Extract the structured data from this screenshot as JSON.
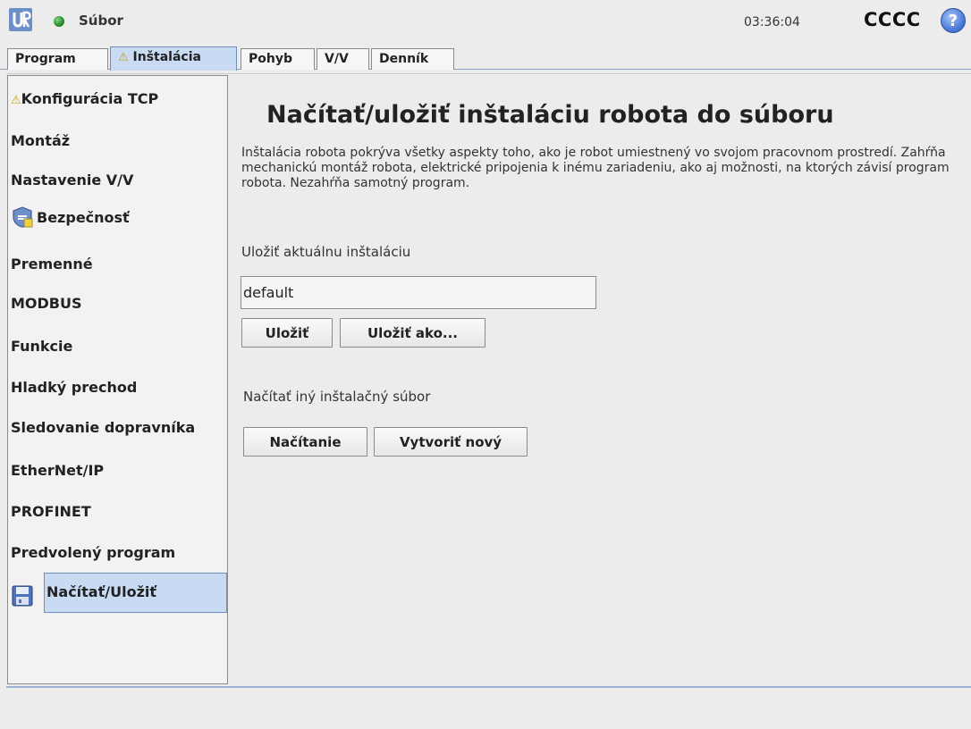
{
  "topbar": {
    "menu_label": "Súbor",
    "clock": "03:36:04",
    "robot_name": "CCCC",
    "help_symbol": "?"
  },
  "tabs": [
    {
      "label": "Program",
      "warning": false,
      "active": false
    },
    {
      "label": "Inštalácia",
      "warning": true,
      "active": true
    },
    {
      "label": "Pohyb",
      "warning": false,
      "active": false
    },
    {
      "label": "V/V",
      "warning": false,
      "active": false
    },
    {
      "label": "Denník",
      "warning": false,
      "active": false
    }
  ],
  "sidebar": {
    "items": [
      {
        "label": "Konfigurácia TCP",
        "icon": "warning-icon"
      },
      {
        "label": "Montáž"
      },
      {
        "label": "Nastavenie V/V"
      },
      {
        "label": "Bezpečnosť",
        "icon": "shield-icon"
      },
      {
        "label": "Premenné"
      },
      {
        "label": "MODBUS"
      },
      {
        "label": "Funkcie"
      },
      {
        "label": "Hladký prechod"
      },
      {
        "label": "Sledovanie dopravníka"
      },
      {
        "label": "EtherNet/IP"
      },
      {
        "label": "PROFINET"
      },
      {
        "label": "Predvolený program"
      },
      {
        "label": "Načítať/Uložiť",
        "icon": "floppy-disk-icon",
        "selected": true
      }
    ]
  },
  "main": {
    "title": "Načítať/uložiť inštaláciu robota do súboru",
    "description": "Inštalácia robota pokrýva všetky aspekty toho, ako je robot umiestnený vo svojom pracovnom prostredí. Zahŕňa mechanickú montáž robota, elektrické pripojenia k inému zariadeniu, ako aj možnosti, na ktorých závisí program robota. Nezahŕňa samotný program.",
    "save_section_label": "Uložiť aktuálnu inštaláciu",
    "installation_name_value": "default",
    "save_button": "Uložiť",
    "save_as_button": "Uložiť ako...",
    "load_section_label": "Načítať iný inštalačný súbor",
    "load_button": "Načítanie",
    "create_new_button": "Vytvoriť nový"
  },
  "colors": {
    "accent_selected": "#c9dbf2",
    "status_green": "#2a8a2a",
    "help_blue": "#4d7ddc",
    "warning_yellow": "#c9a400"
  }
}
